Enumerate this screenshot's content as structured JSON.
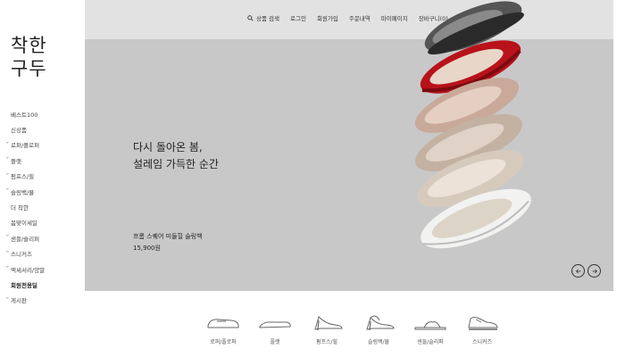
{
  "logo": {
    "line1": "착한",
    "line2": "구두"
  },
  "sidebar": {
    "items": [
      {
        "label": "베스트100",
        "chevron": false,
        "bold": false
      },
      {
        "label": "신상품",
        "chevron": false,
        "bold": false
      },
      {
        "label": "로퍼/플로퍼",
        "chevron": true,
        "bold": false
      },
      {
        "label": "플랫",
        "chevron": true,
        "bold": false
      },
      {
        "label": "펌프스/힐",
        "chevron": true,
        "bold": false
      },
      {
        "label": "슬링백/뮬",
        "chevron": true,
        "bold": false
      },
      {
        "label": "더 착한",
        "chevron": false,
        "bold": false
      },
      {
        "label": "봄맞이세일",
        "chevron": false,
        "bold": false
      },
      {
        "label": "샌들/슬리퍼",
        "chevron": true,
        "bold": false
      },
      {
        "label": "스니커즈",
        "chevron": true,
        "bold": false
      },
      {
        "label": "액세서리/양말",
        "chevron": true,
        "bold": false
      },
      {
        "label": "회원전용딜",
        "chevron": false,
        "bold": true
      },
      {
        "label": "게시판",
        "chevron": true,
        "bold": false
      }
    ]
  },
  "topnav": {
    "search_label": "상품 검색",
    "login": "로그인",
    "join": "회원가입",
    "orders": "주문내역",
    "mypage": "마이페이지",
    "cart": "장바구니(0)"
  },
  "banner": {
    "headline_line1": "다시 돌아온 봄,",
    "headline_line2": "설레임 가득한 순간",
    "product_name": "프롬 스퀘어 미들힐 슬링백",
    "product_price": "15,900원"
  },
  "categories": [
    {
      "label": "로퍼/플로퍼",
      "icon": "loafer-icon"
    },
    {
      "label": "플랫",
      "icon": "flat-icon"
    },
    {
      "label": "펌프스/힐",
      "icon": "pump-icon"
    },
    {
      "label": "슬링백/뮬",
      "icon": "slingback-icon"
    },
    {
      "label": "샌들/슬리퍼",
      "icon": "sandal-icon"
    },
    {
      "label": "스니커즈",
      "icon": "sneaker-icon"
    }
  ],
  "colors": {
    "banner_bg": "#c8c8c9",
    "nav_bg": "#e2e2e2",
    "shoe_red": "#b8121a",
    "shoe_black": "#2a2a2a",
    "shoe_beige": "#cdb7a3",
    "shoe_white": "#f2f2f0"
  }
}
